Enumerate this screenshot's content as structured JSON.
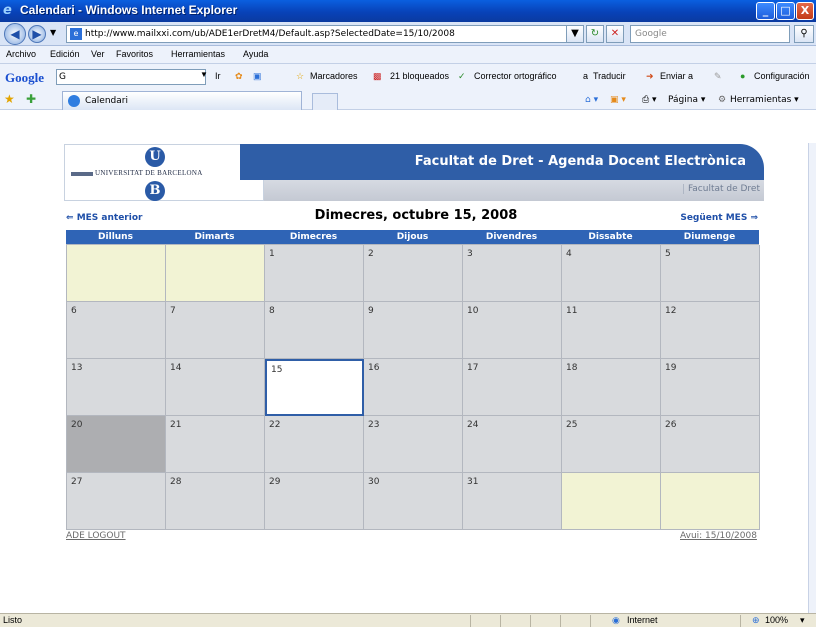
{
  "window": {
    "title": "Calendari - Windows Internet Explorer",
    "min": "_",
    "max": "□",
    "close": "X"
  },
  "address": {
    "url": "http://www.mailxxi.com/ub/ADE1erDretM4/Default.asp?SelectedDate=15/10/2008",
    "search_placeholder": "Google"
  },
  "menu": [
    "Archivo",
    "Edición",
    "Ver",
    "Favoritos",
    "Herramientas",
    "Ayuda"
  ],
  "google_toolbar": {
    "logo": "Google",
    "search_value": "G",
    "go": "Ir",
    "bookmarks": "Marcadores",
    "blocked": "21 bloqueados",
    "spell": "Corrector ortográfico",
    "translate": "Traducir",
    "send": "Enviar a",
    "settings": "Configuración"
  },
  "tabs": {
    "active_label": "Calendari"
  },
  "commandbar": {
    "page": "Página",
    "tools": "Herramientas"
  },
  "banner": {
    "ub_top": "U",
    "ub_bottom": "B",
    "university": "UNIVERSITAT DE BARCELONA",
    "title": "Facultat de Dret - Agenda Docent Electrònica",
    "sublink": "Facultat de Dret"
  },
  "nav": {
    "prev": "MES anterior",
    "current": "Dimecres, octubre 15, 2008",
    "next": "Següent MES"
  },
  "calendar": {
    "weekdays": [
      "Dilluns",
      "Dimarts",
      "Dimecres",
      "Dijous",
      "Divendres",
      "Dissabte",
      "Diumenge"
    ],
    "cells": [
      {
        "day": "",
        "state": "empty"
      },
      {
        "day": "",
        "state": "empty"
      },
      {
        "day": "1",
        "state": "normal"
      },
      {
        "day": "2",
        "state": "normal"
      },
      {
        "day": "3",
        "state": "normal"
      },
      {
        "day": "4",
        "state": "normal"
      },
      {
        "day": "5",
        "state": "normal"
      },
      {
        "day": "6",
        "state": "normal"
      },
      {
        "day": "7",
        "state": "normal"
      },
      {
        "day": "8",
        "state": "normal"
      },
      {
        "day": "9",
        "state": "normal"
      },
      {
        "day": "10",
        "state": "normal"
      },
      {
        "day": "11",
        "state": "normal"
      },
      {
        "day": "12",
        "state": "normal"
      },
      {
        "day": "13",
        "state": "normal"
      },
      {
        "day": "14",
        "state": "normal"
      },
      {
        "day": "15",
        "state": "today"
      },
      {
        "day": "16",
        "state": "normal"
      },
      {
        "day": "17",
        "state": "normal"
      },
      {
        "day": "18",
        "state": "normal"
      },
      {
        "day": "19",
        "state": "normal"
      },
      {
        "day": "20",
        "state": "past"
      },
      {
        "day": "21",
        "state": "normal"
      },
      {
        "day": "22",
        "state": "normal"
      },
      {
        "day": "23",
        "state": "normal"
      },
      {
        "day": "24",
        "state": "normal"
      },
      {
        "day": "25",
        "state": "normal"
      },
      {
        "day": "26",
        "state": "normal"
      },
      {
        "day": "27",
        "state": "normal"
      },
      {
        "day": "28",
        "state": "normal"
      },
      {
        "day": "29",
        "state": "normal"
      },
      {
        "day": "30",
        "state": "normal"
      },
      {
        "day": "31",
        "state": "normal"
      },
      {
        "day": "",
        "state": "empty"
      },
      {
        "day": "",
        "state": "empty"
      }
    ]
  },
  "footer": {
    "logout": "ADE LOGOUT",
    "today": "Avui: 15/10/2008"
  },
  "status": {
    "text": "Listo",
    "zone": "Internet",
    "zoom": "100%"
  },
  "colors": {
    "accent_blue": "#2f5ea7",
    "cell_grey": "#d8dadd",
    "cell_empty": "#f2f3d4",
    "cell_past": "#adaeb1"
  }
}
